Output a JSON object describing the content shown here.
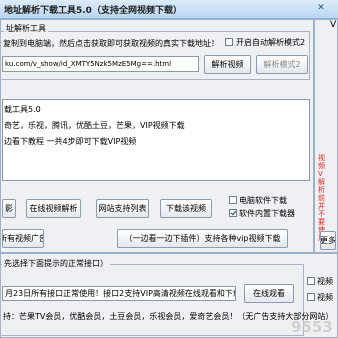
{
  "window": {
    "title": "地址解析下载工具5.0（支持全网视频下载）",
    "close_glyph": "✕"
  },
  "parse_group": {
    "legend": "址解析工具",
    "instruction": "复制到电脑端，然后点击获取即可获取视频的真实下载地址！",
    "auto_parse_label": "开启自动解析模式2",
    "url_value": "ku.com/v_show/id_XMTY5Nzk5MzE5Mg==.html",
    "parse_button": "解析视频",
    "parse_mode2_button": "解析模式2"
  },
  "right_side": {
    "partial_char": "V",
    "red_note": "视频V解析前并不要使用"
  },
  "notes": {
    "lines": [
      "载工具5.0",
      "奇艺，乐视，腾讯，优酷土豆，芒果，VIP视频下载",
      "边看下教程 一共4步即可下载VIP视频"
    ]
  },
  "action_row": {
    "btn_play": "影",
    "btn_online_parse": "在线视频解析",
    "btn_site_list": "网站支持列表",
    "btn_download": "下载该视频",
    "chk_pc_software": "电脑软件下载",
    "chk_inside_downloader": "软件内置下载器"
  },
  "second_row": {
    "btn_ads": "所有视频广告",
    "btn_plugin": "（一边看一边下插件）支持各种vip视频下载",
    "btn_more": "更多"
  },
  "interface_group": {
    "legend": "先选择下面提示的正常接口）",
    "notice": "月23日所有接口正常使用！接口2支持VIP高清视频在线观看和下载",
    "watch_button": "在线观看",
    "support_text": "持：芒果TV会员，优酷会员，土豆会员，乐视会员，爱奇艺会员！（无广告支持大部分网站）",
    "right_chk_1": "视频",
    "right_chk_2": "视频"
  },
  "watermark": "9553"
}
